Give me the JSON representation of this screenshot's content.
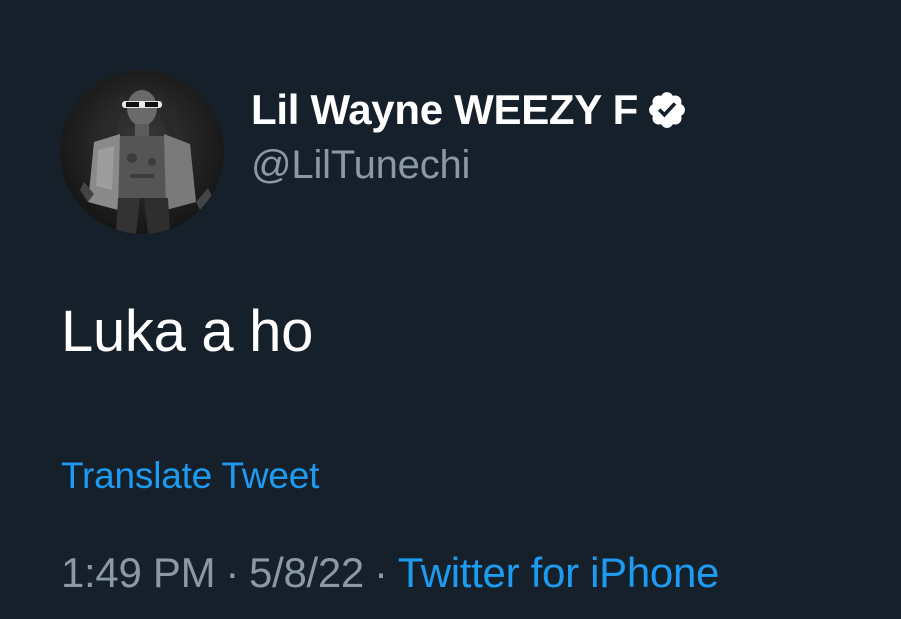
{
  "tweet": {
    "author": {
      "display_name": "Lil Wayne WEEZY F",
      "handle": "@LilTunechi",
      "verified_icon": "verified-badge-icon",
      "avatar_icon": "profile-photo"
    },
    "text": "Luka a ho",
    "translate_label": "Translate Tweet",
    "time": "1:49 PM",
    "separator": "·",
    "date": "5/8/22",
    "source": "Twitter for iPhone"
  },
  "colors": {
    "background": "#15202b",
    "primary_text": "#ffffff",
    "secondary_text": "#8b98a5",
    "link": "#1d9bf0"
  }
}
